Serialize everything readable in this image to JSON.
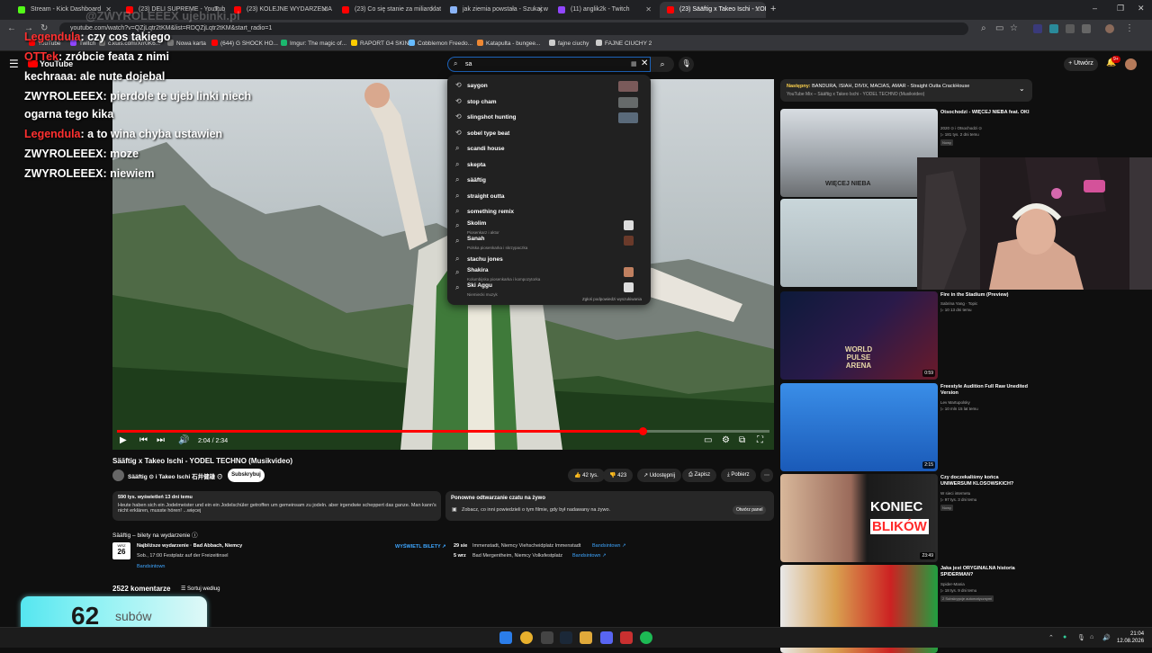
{
  "browser": {
    "tabs": [
      {
        "title": "Stream - Kick Dashboard",
        "color": "#53fc18"
      },
      {
        "title": "(23) DELI SUPREME - YouTube",
        "color": "#ff0000"
      },
      {
        "title": "(23) KOLEJNE WYDARZENIA CO",
        "color": "#ff0000"
      },
      {
        "title": "(23) Co się stanie za miliard lat",
        "color": "#ff0000"
      },
      {
        "title": "jak ziemia powstała - Szukaj w",
        "color": "#8ab4f8"
      },
      {
        "title": "(11) anglik2k - Twitch",
        "color": "#9146ff"
      },
      {
        "title": "(23) Sääftig x Takeo Ischi - YOD",
        "color": "#ff0000"
      }
    ],
    "new_tab": "+",
    "url": "youtube.com/watch?v=QZjLqtr2tKM&list=RDQZjLqtr2tKM&start_radio=1",
    "bookmarks": [
      {
        "label": "YouTube",
        "color": "#ff0000"
      },
      {
        "label": "Twitch",
        "color": "#9146ff"
      },
      {
        "label": "c.kuis.com/Xrr0K6...",
        "color": "#777777"
      },
      {
        "label": "Nowa karta",
        "color": "#777777"
      },
      {
        "label": "(644) G SHOCK HO...",
        "color": "#ff0000"
      },
      {
        "label": "Imgur: The magic of...",
        "color": "#1bb76e"
      },
      {
        "label": "RAPORT G4 SKINS",
        "color": "#ffcc00"
      },
      {
        "label": "Cobblemon Freedo...",
        "color": "#66bbff"
      },
      {
        "label": "Katapulta - bungee...",
        "color": "#ee8833"
      },
      {
        "label": "fajne ciuchy",
        "color": "#cccccc"
      },
      {
        "label": "FAJNE CIUCHY 2",
        "color": "#cccccc"
      }
    ]
  },
  "youtube": {
    "logo": "YouTube",
    "search_value": "sa",
    "search_icon": "search-icon",
    "create_label": "+ Utwórz",
    "notif_count": "9+"
  },
  "suggestions": [
    {
      "text": "saygon",
      "sub": "",
      "icon": "history-icon",
      "thumb": "#7a5a5a"
    },
    {
      "text": "stop cham",
      "sub": "",
      "icon": "history-icon",
      "thumb": "#666a6a"
    },
    {
      "text": "slingshot hunting",
      "sub": "",
      "icon": "history-icon",
      "thumb": "#5a6a7a"
    },
    {
      "text": "sobel type beat",
      "sub": "",
      "icon": "history-icon",
      "thumb": ""
    },
    {
      "text": "scandi house",
      "sub": "",
      "icon": "search-icon",
      "thumb": ""
    },
    {
      "text": "skepta",
      "sub": "",
      "icon": "search-icon",
      "thumb": ""
    },
    {
      "text": "sääftig",
      "sub": "",
      "icon": "search-icon",
      "thumb": ""
    },
    {
      "text": "straight outta",
      "sub": "",
      "icon": "search-icon",
      "thumb": ""
    },
    {
      "text": "something remix",
      "sub": "",
      "icon": "search-icon",
      "thumb": ""
    },
    {
      "text": "Skolim",
      "sub": "Piosenkarz i aktor",
      "icon": "search-icon",
      "thumb": "#ddd"
    },
    {
      "text": "Sanah",
      "sub": "Polska piosenkarka i skrzypaczka",
      "icon": "search-icon",
      "thumb": "#6a3a2a"
    },
    {
      "text": "stachu jones",
      "sub": "",
      "icon": "search-icon",
      "thumb": ""
    },
    {
      "text": "Shakira",
      "sub": "Kolumbijska piosenkarka i kompozytorka",
      "icon": "search-icon",
      "thumb": "#c08060"
    },
    {
      "text": "Ski Aggu",
      "sub": "Niemiecki muzyk",
      "icon": "search-icon",
      "thumb": "#dddddd"
    }
  ],
  "suggest_report": "Zgłoś podpowiedzi wyszukiwania",
  "chat": {
    "watermark": "@ZWYROLEEEX ujebinki.pl",
    "messages": [
      {
        "user": "Legendula",
        "text": ": czy cos takiego",
        "user_color": "#ff3030"
      },
      {
        "user": "OTTek",
        "text": ": zróbcie feata z nimi",
        "user_color": "#ff3030"
      },
      {
        "user": "kechraaa",
        "text": ": ale nute dojebal",
        "user_color": "#ffffff"
      },
      {
        "user": "ZWYROLEEEX",
        "text": ": pierdole te ujeb linki niech",
        "user_color": "#ffffff"
      },
      {
        "user": "",
        "text": "ogarna tego kika",
        "user_color": "#ffffff"
      },
      {
        "user": "Legendula",
        "text": ": a to wina chyba ustawien",
        "user_color": "#ff3030"
      },
      {
        "user": "ZWYROLEEEX",
        "text": ": moze",
        "user_color": "#ffffff"
      },
      {
        "user": "ZWYROLEEEX",
        "text": ": niewiem",
        "user_color": "#ffffff"
      }
    ]
  },
  "player": {
    "time": "2:04 / 2:34",
    "progress": 0.805
  },
  "video": {
    "title": "Sääftig x Takeo Ischi - YODEL TECHNO (Musikvideo)",
    "channel": "Sääftig ⊙ i Takeo Ischi 石井健雄 ⊙",
    "subscribe": "Subskrybuj",
    "likes": "42 tys.",
    "dislikes": "423",
    "share": "Udostępnij",
    "save": "Zapisz",
    "download": "Pobierz",
    "desc_stats": "590 tys. wyświetleń  13 dni temu",
    "desc_text": "Heute haben sich ein Jodelmeister und ein ein Jodelschüler getroffen um gemeinsam zu jodeln. aber irgendwie scheppert das ganze. Man kann's nicht erklären, musste hören! ...więcej",
    "replay_title": "Ponowne odtwarzanie czatu na żywo",
    "replay_text": "Zobacz, co inni powiedzieli o tym filmie, gdy był nadawany na żywo.",
    "replay_btn": "Otwórz panel",
    "tickets_head": "Sääftig – bilety na wydarzenie ⓘ",
    "event_month": "WRZ",
    "event_day": "26",
    "event_title": "Najbliższe wydarzenie · Bad Abbach, Niemcy",
    "event_place": "Sob., 17:00 Festplatz auf der Freizeitinsel",
    "event_link": "Bandsintown",
    "tickets_btn": "WYŚWIETL BILETY ↗",
    "ev2_date": "29 sie",
    "ev2_place": "Immenstadt, Niemcy Viehscheidplatz Immenstadt",
    "ev2_link": "Bandsintown ↗",
    "ev3_date": "5 wrz",
    "ev3_place": "Bad Mergentheim, Niemcy Volksfestplatz",
    "ev3_link": "Bandsintown ↗",
    "comments": "2522 komentarze",
    "sort": "Sortuj według"
  },
  "sidebar": {
    "nextup_label": "Następny:",
    "nextup_title": "BANDURA, ISIAH, DIVIX, MACIAS, AMAR - Straight Outta CrackHouse",
    "nextup_sub": "YouTube Mix – Sääftig x Takeo Ischi - YODEL TECHNO (Musikvideo)",
    "recs": [
      {
        "title": "Otsochodzi - WIĘCEJ NIEBA feat. OKI",
        "channel": "2020 ⊙ i Otsochodzi ⊙",
        "meta": "▷ 181 tys.  2 dni temu",
        "badge": "Nowy",
        "duration": ""
      },
      {
        "title": "",
        "channel": "",
        "meta": "",
        "badge": "",
        "duration": ""
      },
      {
        "title": "Fire in the Stadium (Preview)",
        "channel": "Sabrina Yang · Topic",
        "meta": "▷ 10  13 dni temu",
        "badge": "",
        "duration": "0:59"
      },
      {
        "title": "Freestyle Audition Full Raw Unedited Version",
        "channel": "Lev Martupolsky",
        "meta": "▷ 10 mln  15 lat temu",
        "badge": "",
        "duration": "2:15"
      },
      {
        "title": "Czy doczekaliśmy końca UNIWERSUM KLOSOWSKICH?",
        "channel": "W sieci internetu",
        "meta": "▷ 97 tys.  3 dni temu",
        "badge": "Nowy",
        "duration": "23:49"
      },
      {
        "title": "Jaka jest ORYGINALNA historia SPIDERMAN?",
        "channel": "Spider-Mania",
        "meta": "▷ 18 tys.  9 dni temu",
        "badge": "2 Subskrypcje automatycznymi",
        "duration": ""
      }
    ],
    "thumb_texts": {
      "koniec": "KONIEC",
      "blikow": "BLIKÓW",
      "arena": "WORLD PULSE ARENA",
      "wiecej": "WIĘCEJ NIEBA"
    }
  },
  "subcounter": {
    "value": "62",
    "label": "subów"
  },
  "taskbar": {
    "time": "21:04",
    "date": "12.08.2026"
  }
}
